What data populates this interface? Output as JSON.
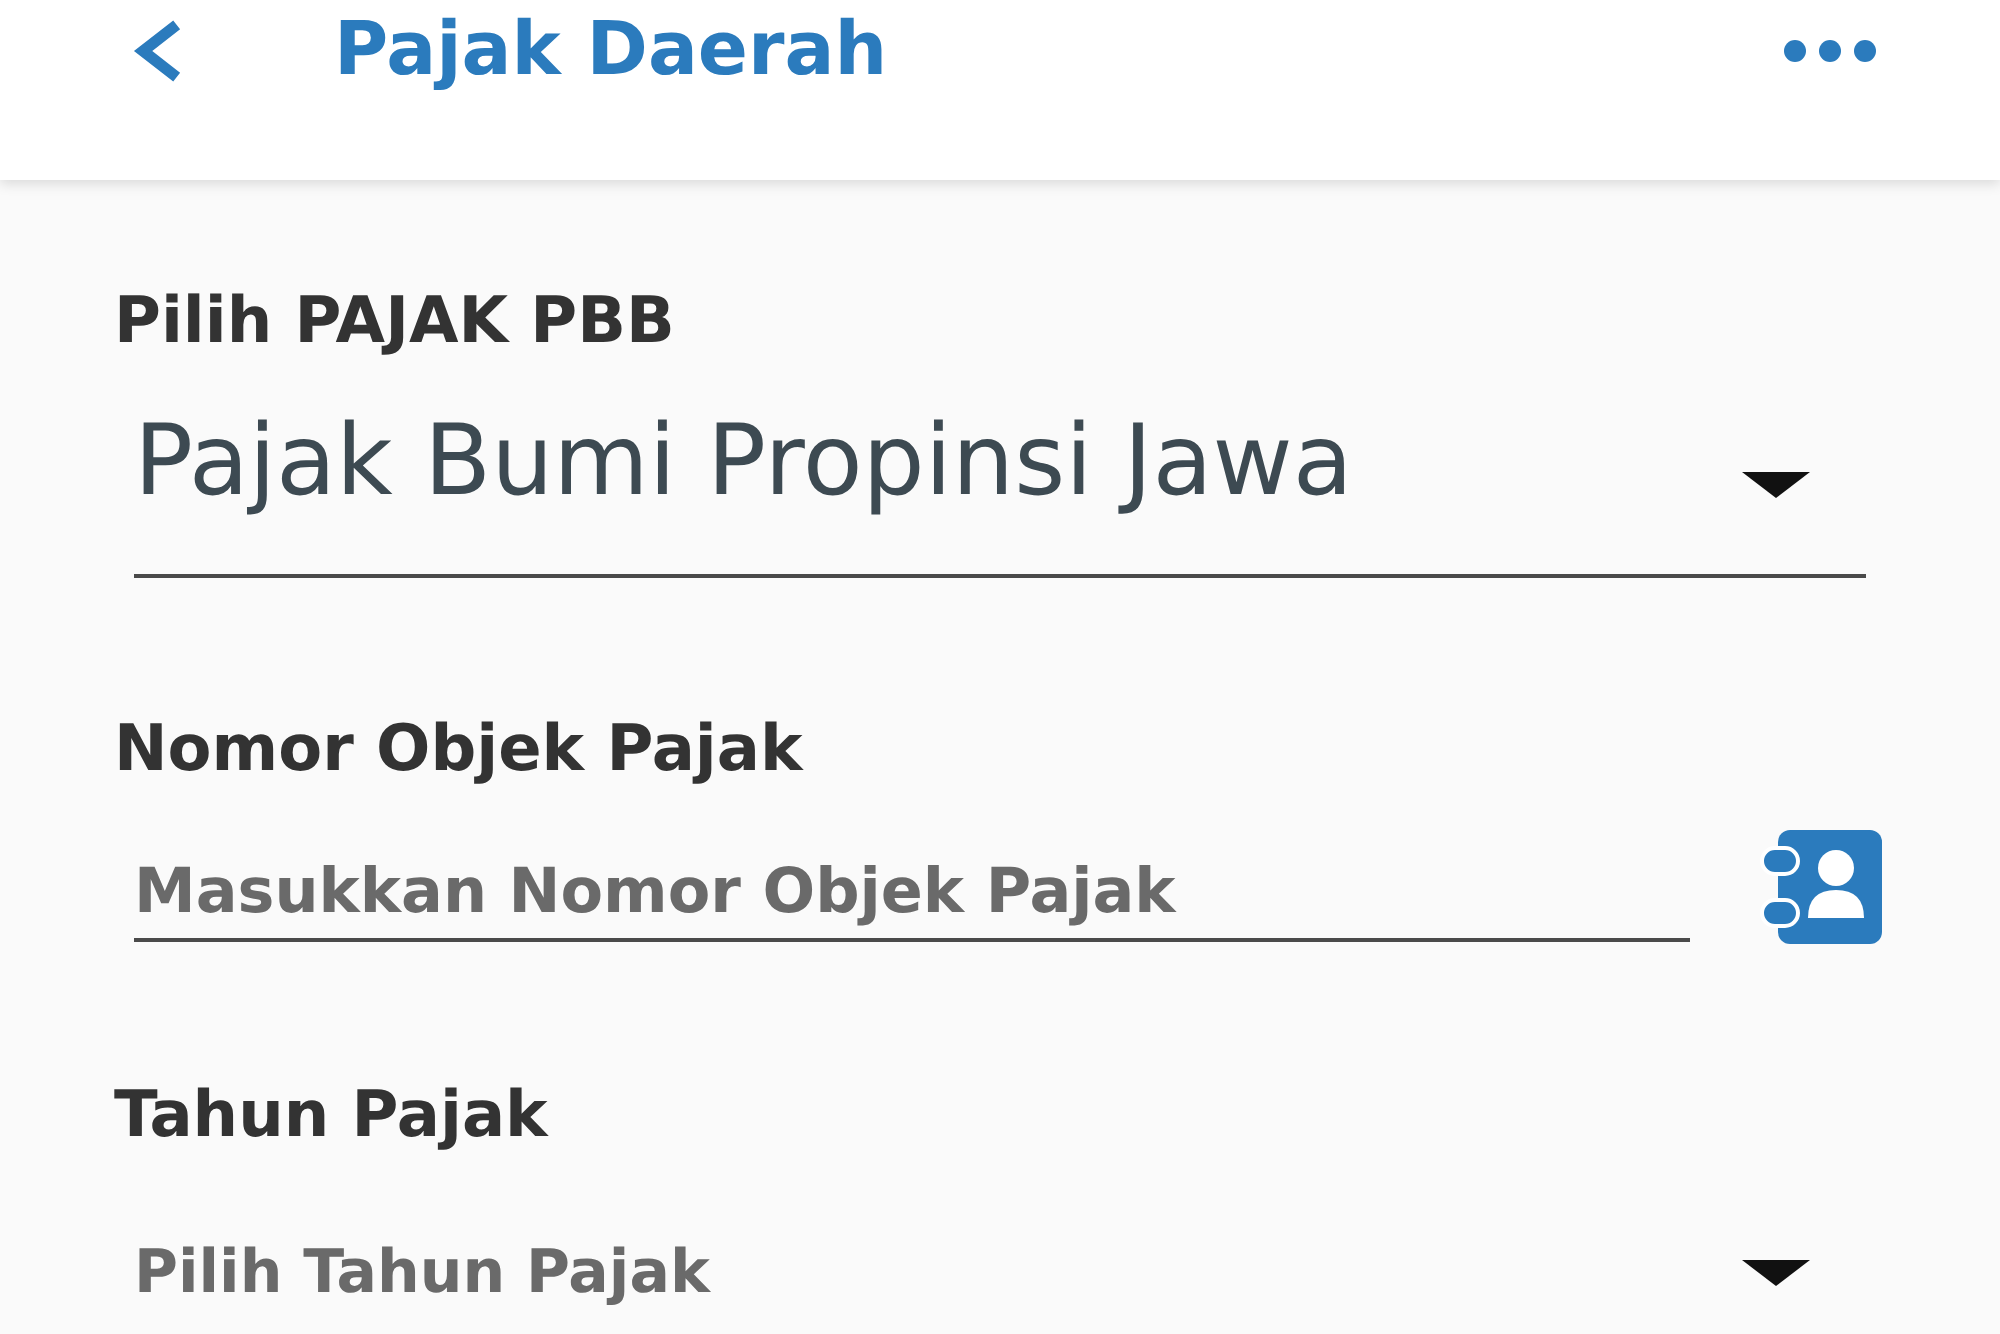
{
  "app_bar": {
    "title": "Pajak Daerah"
  },
  "fields": [
    {
      "kind": "dropdown",
      "label": "Pilih PAJAK PBB",
      "value": "Pajak Bumi Propinsi Jawa"
    },
    {
      "kind": "text_input",
      "label": "Nomor Objek Pajak",
      "placeholder": "Masukkan Nomor Objek Pajak"
    },
    {
      "kind": "dropdown",
      "label": "Tahun Pajak",
      "placeholder": "Pilih Tahun Pajak"
    }
  ]
}
